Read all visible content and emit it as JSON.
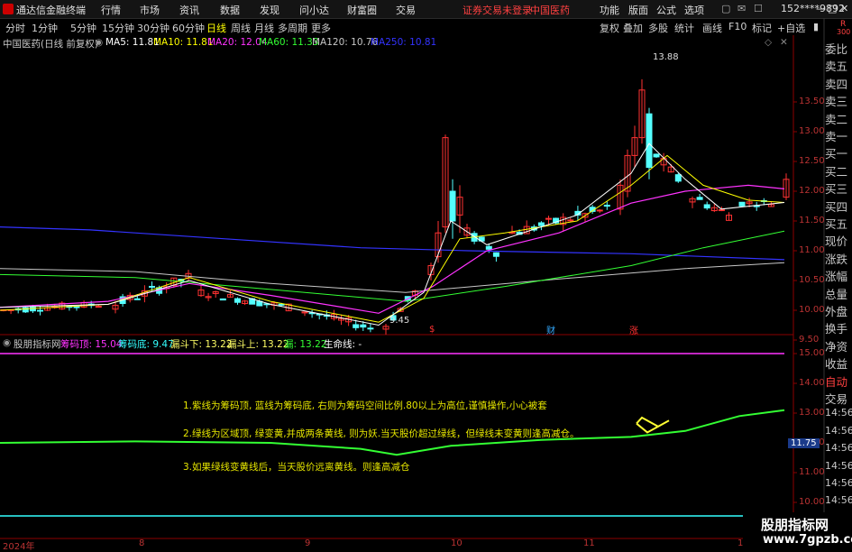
{
  "topbar": {
    "app_title": "通达信金融终端",
    "menu": [
      "行情",
      "市场",
      "资讯",
      "数据",
      "发现",
      "问小达",
      "财富圈",
      "交易"
    ],
    "status_warning": "证券交易未登录",
    "stock_name_tag": "中国医药",
    "right_menu": [
      "功能",
      "版面",
      "公式",
      "选项"
    ],
    "user": "152****9892",
    "window_controls": [
      "—",
      "□",
      "✕"
    ]
  },
  "periodbar": {
    "tabs": [
      "分时",
      "1分钟",
      "5分钟",
      "15分钟",
      "30分钟",
      "60分钟",
      "日线",
      "周线",
      "月线",
      "多周期",
      "更多"
    ],
    "active": "日线",
    "tools": [
      "复权",
      "叠加",
      "多股",
      "统计",
      "画线",
      "F10",
      "标记",
      "+自选"
    ]
  },
  "main_chart": {
    "title": "中国医药(日线 前复权)",
    "ma_labels": [
      {
        "text": "MA5: 11.81",
        "color": "#ffffff"
      },
      {
        "text": "MA10: 11.81",
        "color": "#ffff00"
      },
      {
        "text": "MA20: 12.04",
        "color": "#ff33ff"
      },
      {
        "text": "MA60: 11.33",
        "color": "#33ff33"
      },
      {
        "text": "MA120: 10.76",
        "color": "#c8c8c8"
      },
      {
        "text": "MA250: 10.81",
        "color": "#3333ff"
      }
    ],
    "price_axis": [
      "13.50",
      "13.00",
      "12.50",
      "12.00",
      "11.50",
      "11.00",
      "10.50",
      "10.00",
      "9.50"
    ],
    "high_label": "13.88",
    "low_label": "9.45",
    "event_markers": [
      "$",
      "财",
      "涨"
    ]
  },
  "sidebar": {
    "items": [
      "委比",
      "卖五",
      "卖四",
      "卖三",
      "卖二",
      "卖一",
      "买一",
      "买二",
      "买三",
      "买四",
      "买五",
      "现价",
      "涨跌",
      "涨幅",
      "总量",
      "外盘",
      "换手",
      "净资",
      "收益",
      "自动",
      "交易",
      "14:56",
      "14:56",
      "14:56",
      "14:56",
      "14:56",
      "14:56",
      "14:56",
      "14:56"
    ],
    "corner_r": "R",
    "corner_num": "300"
  },
  "indicator": {
    "name": "股朋指标网",
    "labels": [
      {
        "text": "筹码顶: 15.04",
        "color": "#ff33ff"
      },
      {
        "text": "筹码底: 9.47",
        "color": "#33ffff"
      },
      {
        "text": "漏斗下: 13.22",
        "color": "#ffff66"
      },
      {
        "text": "漏斗上: 13.22",
        "color": "#ffff66"
      },
      {
        "text": "漏: 13.22",
        "color": "#33ff33"
      },
      {
        "text": "生命线: -",
        "color": "#ffffff"
      }
    ],
    "axis": [
      "15.00",
      "14.00",
      "13.00",
      "12.00",
      "11.00",
      "10.00"
    ],
    "current_value": "11.75",
    "notes": [
      "1.紫线为筹码顶, 蓝线为筹码底, 右则为筹码空间比例.80以上为高位,谨慎操作,小心被套",
      "2.绿线为区域顶, 绿变黄,并成两条黄线, 则为妖.当天股价超过绿线，但绿线未变黄则逢高减仓。",
      "3.如果绿线变黄线后，当天股价远离黄线。则逢高减仓"
    ]
  },
  "xaxis": [
    "2024年",
    "8",
    "9",
    "10",
    "11",
    "1"
  ],
  "watermark": {
    "line1": "股朋指标网",
    "line2": "www.7gpzb.com"
  },
  "colors": {
    "up": "#ff3232",
    "down": "#54ffff",
    "grid": "#8b0000",
    "accent": "#ff4040"
  }
}
